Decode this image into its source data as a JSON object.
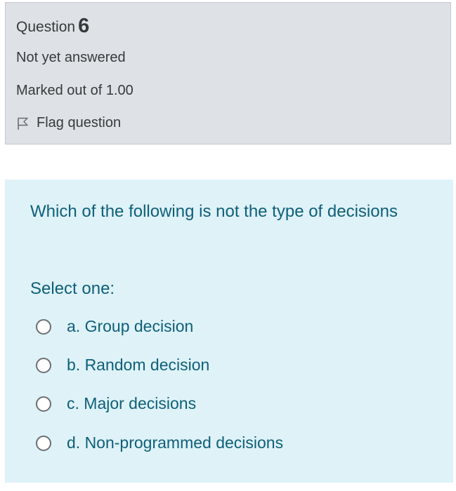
{
  "info": {
    "question_label": "Question",
    "question_number": "6",
    "state": "Not yet answered",
    "grade": "Marked out of 1.00",
    "flag_label": "Flag question"
  },
  "content": {
    "question_text": "Which of the following is not the type of decisions",
    "prompt": "Select one:",
    "answers": [
      {
        "label": "a. Group decision",
        "selected": false
      },
      {
        "label": "b. Random decision",
        "selected": false
      },
      {
        "label": "c. Major decisions",
        "selected": false
      },
      {
        "label": "d. Non-programmed decisions",
        "selected": false
      }
    ]
  },
  "colors": {
    "info_background": "#dee2e6",
    "content_background": "#def2f8",
    "question_text": "#0f5f79",
    "info_text": "#373a3c"
  }
}
